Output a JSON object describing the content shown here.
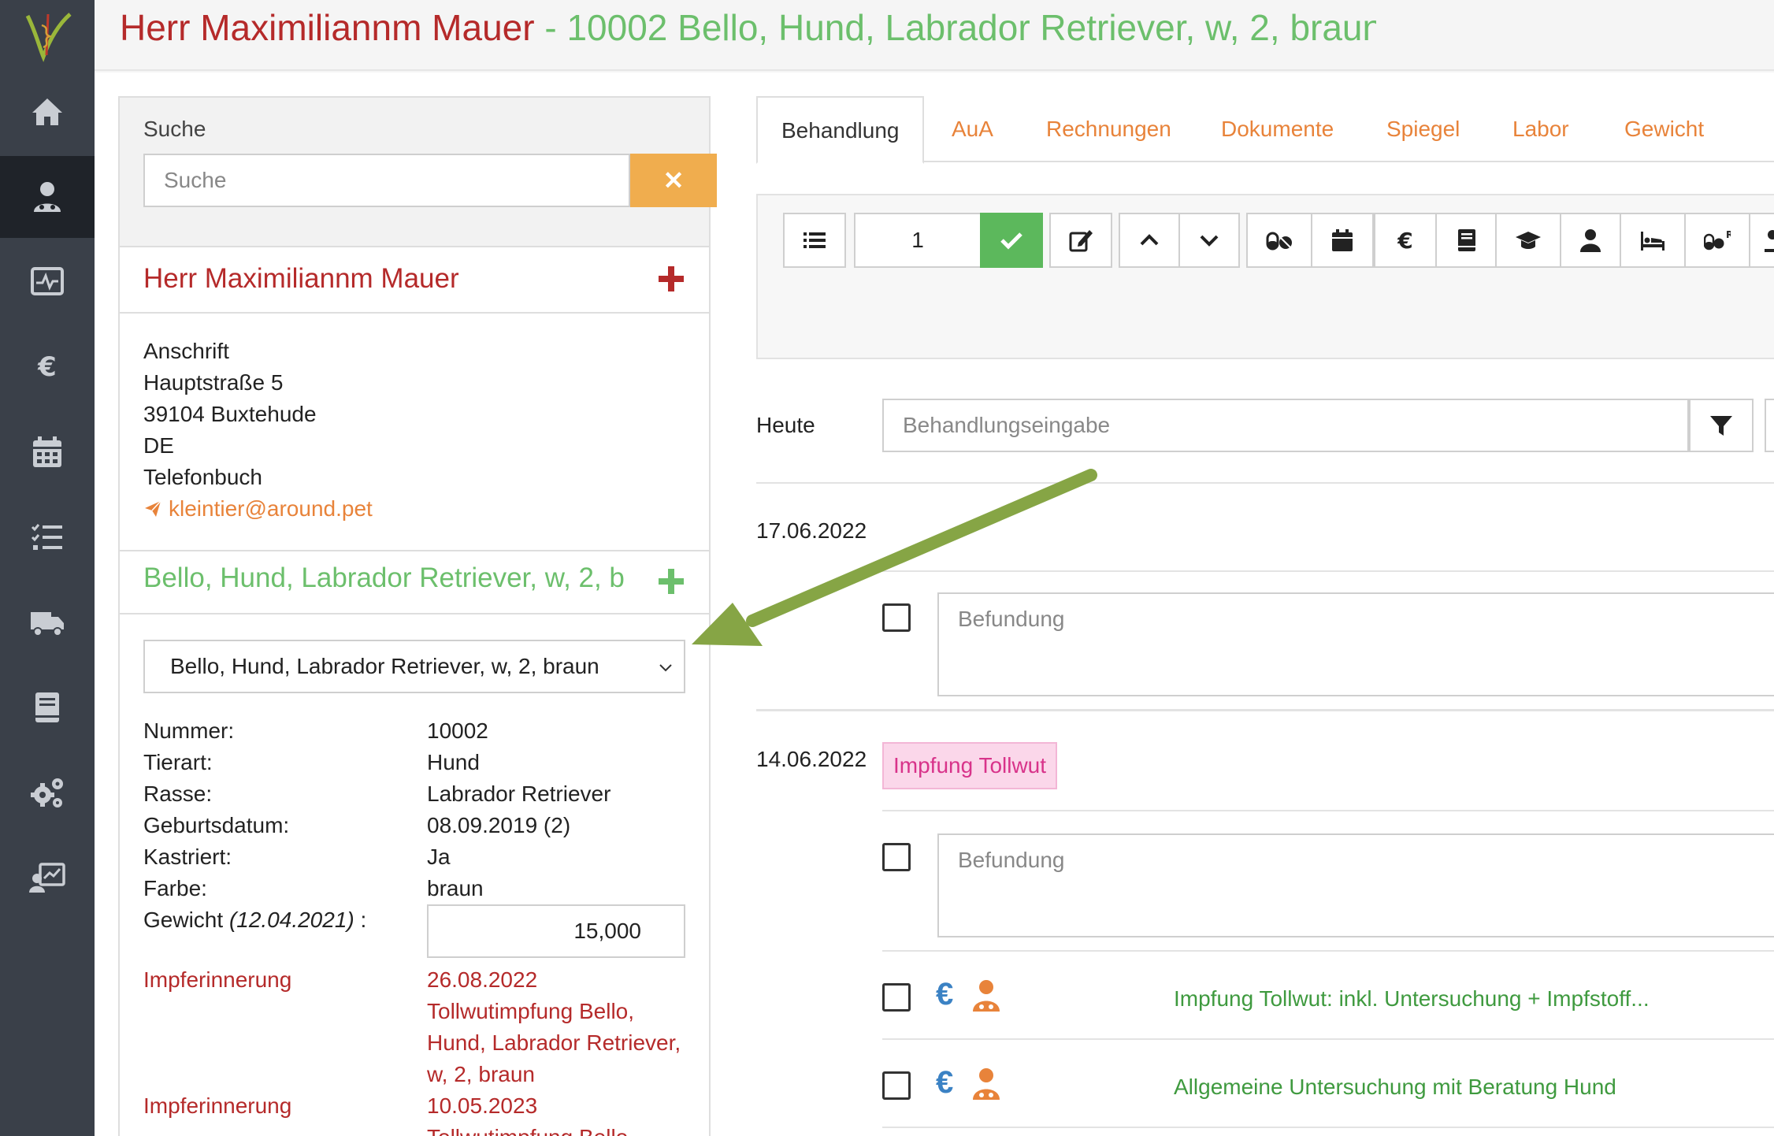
{
  "header": {
    "owner": "Herr Maximiliannm Mauer",
    "patient": " - 10002 Bello, Hund, Labrador Retriever, w, 2, braun"
  },
  "sidebar": {
    "items": [
      {
        "icon": "home-icon"
      },
      {
        "icon": "patient-icon"
      },
      {
        "icon": "monitor-icon"
      },
      {
        "icon": "euro-icon"
      },
      {
        "icon": "calendar-icon"
      },
      {
        "icon": "tasks-icon"
      },
      {
        "icon": "truck-icon"
      },
      {
        "icon": "book-icon"
      },
      {
        "icon": "settings-icon"
      },
      {
        "icon": "statistics-icon"
      }
    ]
  },
  "search": {
    "label": "Suche",
    "placeholder": "Suche",
    "clear": "✕"
  },
  "owner": {
    "name": "Herr Maximiliannm Mauer",
    "address_label": "Anschrift",
    "street": "Hauptstraße 5",
    "city": "39104  Buxtehude",
    "country": "DE",
    "phone_label": "Telefonbuch",
    "email": "kleintier@around.pet"
  },
  "animal": {
    "name": "Bello, Hund, Labrador Retriever, w, 2, braun",
    "selected": "Bello, Hund, Labrador Retriever, w, 2, braun",
    "details": [
      {
        "label": "Nummer:",
        "value": "10002"
      },
      {
        "label": "Tierart:",
        "value": "Hund"
      },
      {
        "label": "Rasse:",
        "value": "Labrador Retriever"
      },
      {
        "label": "Geburtsdatum:",
        "value": "08.09.2019  (2)"
      },
      {
        "label": "Kastriert:",
        "value": "Ja"
      },
      {
        "label": "Farbe:",
        "value": "braun"
      }
    ],
    "weight_label": "Gewicht ",
    "weight_date": "(12.04.2021)",
    "weight_suffix": " :",
    "weight_value": "15,000",
    "reminders": [
      {
        "label": "Impferinnerung",
        "date": "26.08.2022",
        "text": "Tollwutimpfung Bello, Hund, Labrador Retriever, w, 2, braun"
      },
      {
        "label": "Impferinnerung",
        "date": "10.05.2023",
        "text": "Tollwutimpfung Bello,"
      }
    ]
  },
  "tabs": [
    {
      "label": "Behandlung",
      "active": true
    },
    {
      "label": "AuA"
    },
    {
      "label": "Rechnungen"
    },
    {
      "label": "Dokumente"
    },
    {
      "label": "Spiegel"
    },
    {
      "label": "Labor"
    },
    {
      "label": "Gewicht"
    }
  ],
  "toolbar": {
    "count_value": "1"
  },
  "treatment": {
    "today_label": "Heute",
    "input_placeholder": "Behandlungseingabe"
  },
  "entries": [
    {
      "date": "17.06.2022",
      "befund_placeholder": "Befundung"
    },
    {
      "date": "14.06.2022",
      "tag": "Impfung Tollwut",
      "befund_placeholder": "Befundung",
      "items": [
        {
          "text": "Impfung Tollwut: inkl. Untersuchung + Impfstoff..."
        },
        {
          "text": "Allgemeine Untersuchung mit Beratung Hund"
        }
      ]
    }
  ],
  "colors": {
    "owner_red": "#b52a2a",
    "patient_green": "#6cbf6c",
    "link_orange": "#e8833a",
    "ok_green": "#5cb85c",
    "arrow_green": "#86a545",
    "sidebar_bg": "#3a4049"
  }
}
